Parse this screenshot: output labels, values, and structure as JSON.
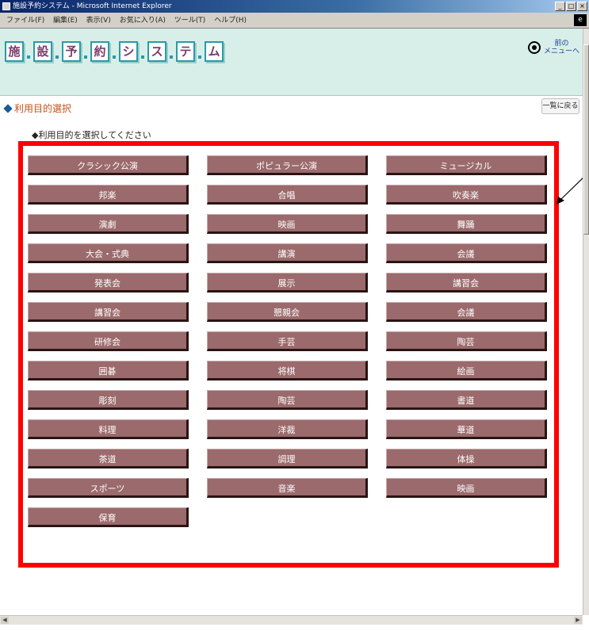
{
  "window": {
    "title": "施設予約システム - Microsoft Internet Explorer",
    "buttons": [
      "_",
      "□",
      "×"
    ]
  },
  "menubar": {
    "items": [
      "ファイル(F)",
      "編集(E)",
      "表示(V)",
      "お気に入り(A)",
      "ツール(T)",
      "ヘルプ(H)"
    ]
  },
  "header": {
    "banner_chars": [
      "施",
      "設",
      "予",
      "約",
      "シ",
      "ス",
      "テ",
      "ム"
    ],
    "menu_link": "前の\nメニューへ",
    "icon": "circle-dot-icon"
  },
  "page": {
    "title": "利用目的選択",
    "back_label": "一覧に戻る",
    "instruction": "◆利用目的を選択してください"
  },
  "purposes": [
    "クラシック公演",
    "ポピュラー公演",
    "ミュージカル",
    "邦楽",
    "合唱",
    "吹奏楽",
    "演劇",
    "映画",
    "舞踊",
    "大会・式典",
    "講演",
    "会議",
    "発表会",
    "展示",
    "講習会",
    "講習会",
    "懇親会",
    "会議",
    "研修会",
    "手芸",
    "陶芸",
    "囲碁",
    "将棋",
    "絵画",
    "彫刻",
    "陶芸",
    "書道",
    "料理",
    "洋裁",
    "華道",
    "茶道",
    "調理",
    "体操",
    "スポーツ",
    "音楽",
    "映画",
    "保育"
  ],
  "colors": {
    "button_fill": "#9b6a6c",
    "header_band": "#d8efe9",
    "highlight_border": "#ff0000",
    "title_text": "#c4521a"
  }
}
